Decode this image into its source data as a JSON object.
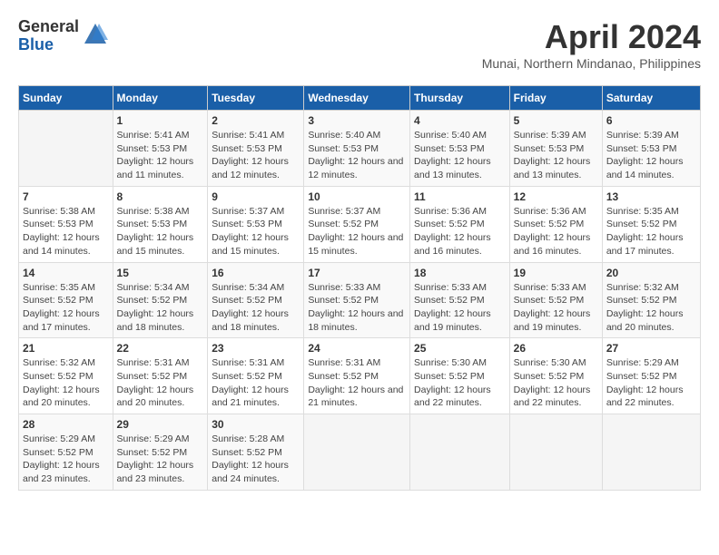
{
  "logo": {
    "general": "General",
    "blue": "Blue"
  },
  "title": "April 2024",
  "location": "Munai, Northern Mindanao, Philippines",
  "days_header": [
    "Sunday",
    "Monday",
    "Tuesday",
    "Wednesday",
    "Thursday",
    "Friday",
    "Saturday"
  ],
  "weeks": [
    [
      {
        "day": "",
        "sunrise": "",
        "sunset": "",
        "daylight": ""
      },
      {
        "day": "1",
        "sunrise": "Sunrise: 5:41 AM",
        "sunset": "Sunset: 5:53 PM",
        "daylight": "Daylight: 12 hours and 11 minutes."
      },
      {
        "day": "2",
        "sunrise": "Sunrise: 5:41 AM",
        "sunset": "Sunset: 5:53 PM",
        "daylight": "Daylight: 12 hours and 12 minutes."
      },
      {
        "day": "3",
        "sunrise": "Sunrise: 5:40 AM",
        "sunset": "Sunset: 5:53 PM",
        "daylight": "Daylight: 12 hours and 12 minutes."
      },
      {
        "day": "4",
        "sunrise": "Sunrise: 5:40 AM",
        "sunset": "Sunset: 5:53 PM",
        "daylight": "Daylight: 12 hours and 13 minutes."
      },
      {
        "day": "5",
        "sunrise": "Sunrise: 5:39 AM",
        "sunset": "Sunset: 5:53 PM",
        "daylight": "Daylight: 12 hours and 13 minutes."
      },
      {
        "day": "6",
        "sunrise": "Sunrise: 5:39 AM",
        "sunset": "Sunset: 5:53 PM",
        "daylight": "Daylight: 12 hours and 14 minutes."
      }
    ],
    [
      {
        "day": "7",
        "sunrise": "Sunrise: 5:38 AM",
        "sunset": "Sunset: 5:53 PM",
        "daylight": "Daylight: 12 hours and 14 minutes."
      },
      {
        "day": "8",
        "sunrise": "Sunrise: 5:38 AM",
        "sunset": "Sunset: 5:53 PM",
        "daylight": "Daylight: 12 hours and 15 minutes."
      },
      {
        "day": "9",
        "sunrise": "Sunrise: 5:37 AM",
        "sunset": "Sunset: 5:53 PM",
        "daylight": "Daylight: 12 hours and 15 minutes."
      },
      {
        "day": "10",
        "sunrise": "Sunrise: 5:37 AM",
        "sunset": "Sunset: 5:52 PM",
        "daylight": "Daylight: 12 hours and 15 minutes."
      },
      {
        "day": "11",
        "sunrise": "Sunrise: 5:36 AM",
        "sunset": "Sunset: 5:52 PM",
        "daylight": "Daylight: 12 hours and 16 minutes."
      },
      {
        "day": "12",
        "sunrise": "Sunrise: 5:36 AM",
        "sunset": "Sunset: 5:52 PM",
        "daylight": "Daylight: 12 hours and 16 minutes."
      },
      {
        "day": "13",
        "sunrise": "Sunrise: 5:35 AM",
        "sunset": "Sunset: 5:52 PM",
        "daylight": "Daylight: 12 hours and 17 minutes."
      }
    ],
    [
      {
        "day": "14",
        "sunrise": "Sunrise: 5:35 AM",
        "sunset": "Sunset: 5:52 PM",
        "daylight": "Daylight: 12 hours and 17 minutes."
      },
      {
        "day": "15",
        "sunrise": "Sunrise: 5:34 AM",
        "sunset": "Sunset: 5:52 PM",
        "daylight": "Daylight: 12 hours and 18 minutes."
      },
      {
        "day": "16",
        "sunrise": "Sunrise: 5:34 AM",
        "sunset": "Sunset: 5:52 PM",
        "daylight": "Daylight: 12 hours and 18 minutes."
      },
      {
        "day": "17",
        "sunrise": "Sunrise: 5:33 AM",
        "sunset": "Sunset: 5:52 PM",
        "daylight": "Daylight: 12 hours and 18 minutes."
      },
      {
        "day": "18",
        "sunrise": "Sunrise: 5:33 AM",
        "sunset": "Sunset: 5:52 PM",
        "daylight": "Daylight: 12 hours and 19 minutes."
      },
      {
        "day": "19",
        "sunrise": "Sunrise: 5:33 AM",
        "sunset": "Sunset: 5:52 PM",
        "daylight": "Daylight: 12 hours and 19 minutes."
      },
      {
        "day": "20",
        "sunrise": "Sunrise: 5:32 AM",
        "sunset": "Sunset: 5:52 PM",
        "daylight": "Daylight: 12 hours and 20 minutes."
      }
    ],
    [
      {
        "day": "21",
        "sunrise": "Sunrise: 5:32 AM",
        "sunset": "Sunset: 5:52 PM",
        "daylight": "Daylight: 12 hours and 20 minutes."
      },
      {
        "day": "22",
        "sunrise": "Sunrise: 5:31 AM",
        "sunset": "Sunset: 5:52 PM",
        "daylight": "Daylight: 12 hours and 20 minutes."
      },
      {
        "day": "23",
        "sunrise": "Sunrise: 5:31 AM",
        "sunset": "Sunset: 5:52 PM",
        "daylight": "Daylight: 12 hours and 21 minutes."
      },
      {
        "day": "24",
        "sunrise": "Sunrise: 5:31 AM",
        "sunset": "Sunset: 5:52 PM",
        "daylight": "Daylight: 12 hours and 21 minutes."
      },
      {
        "day": "25",
        "sunrise": "Sunrise: 5:30 AM",
        "sunset": "Sunset: 5:52 PM",
        "daylight": "Daylight: 12 hours and 22 minutes."
      },
      {
        "day": "26",
        "sunrise": "Sunrise: 5:30 AM",
        "sunset": "Sunset: 5:52 PM",
        "daylight": "Daylight: 12 hours and 22 minutes."
      },
      {
        "day": "27",
        "sunrise": "Sunrise: 5:29 AM",
        "sunset": "Sunset: 5:52 PM",
        "daylight": "Daylight: 12 hours and 22 minutes."
      }
    ],
    [
      {
        "day": "28",
        "sunrise": "Sunrise: 5:29 AM",
        "sunset": "Sunset: 5:52 PM",
        "daylight": "Daylight: 12 hours and 23 minutes."
      },
      {
        "day": "29",
        "sunrise": "Sunrise: 5:29 AM",
        "sunset": "Sunset: 5:52 PM",
        "daylight": "Daylight: 12 hours and 23 minutes."
      },
      {
        "day": "30",
        "sunrise": "Sunrise: 5:28 AM",
        "sunset": "Sunset: 5:52 PM",
        "daylight": "Daylight: 12 hours and 24 minutes."
      },
      {
        "day": "",
        "sunrise": "",
        "sunset": "",
        "daylight": ""
      },
      {
        "day": "",
        "sunrise": "",
        "sunset": "",
        "daylight": ""
      },
      {
        "day": "",
        "sunrise": "",
        "sunset": "",
        "daylight": ""
      },
      {
        "day": "",
        "sunrise": "",
        "sunset": "",
        "daylight": ""
      }
    ]
  ]
}
